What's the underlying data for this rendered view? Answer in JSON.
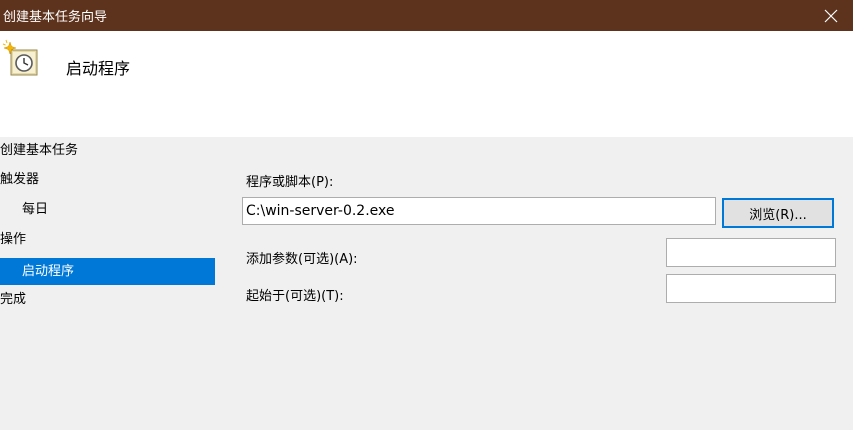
{
  "window": {
    "title": "创建基本任务向导",
    "close_icon": "close-icon"
  },
  "header": {
    "icon": "scheduled-task-clock-icon",
    "title": "启动程序"
  },
  "sidebar": {
    "items": [
      {
        "label": "创建基本任务"
      },
      {
        "label": "触发器"
      },
      {
        "label": "每日"
      },
      {
        "label": "操作"
      },
      {
        "label": "启动程序"
      },
      {
        "label": "完成"
      }
    ],
    "selected_index": 4
  },
  "form": {
    "program_label": "程序或脚本(P):",
    "program_value": "C:\\win-server-0.2.exe",
    "browse_label": "浏览(R)...",
    "args_label": "添加参数(可选)(A):",
    "args_value": "",
    "startin_label": "起始于(可选)(T):",
    "startin_value": ""
  },
  "colors": {
    "titlebar": "#5e331d",
    "selection": "#0078d7",
    "panel": "#f0f0f0"
  }
}
